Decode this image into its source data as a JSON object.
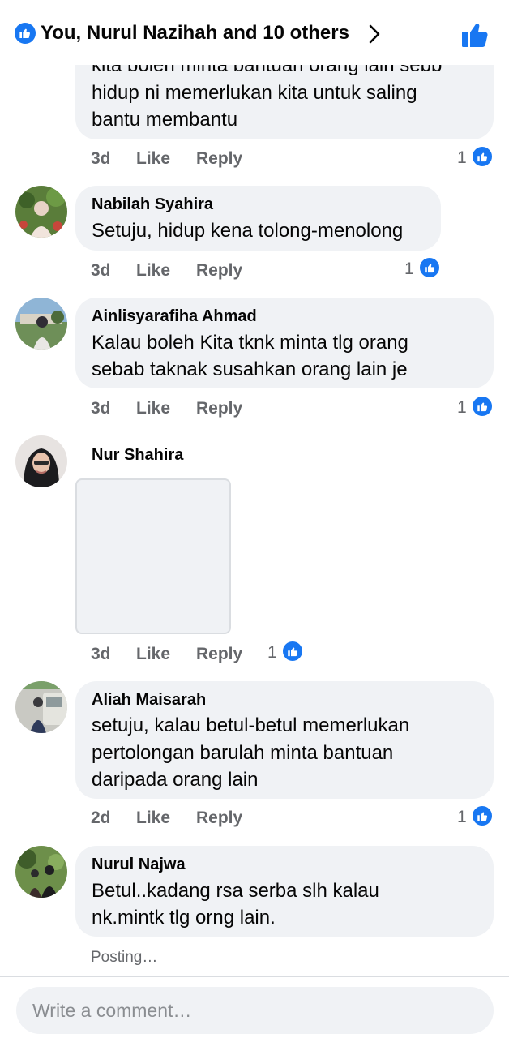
{
  "header": {
    "title": "You, Nurul Nazihah and 10 others"
  },
  "colors": {
    "accent": "#1877f2",
    "bubble": "#f0f2f5",
    "meta": "#65676b"
  },
  "comments": [
    {
      "name": "",
      "lines": [
        "kita boleh minta bantuan orang lain sebb",
        "hidup ni memerlukan kita untuk saling",
        "bantu membantu"
      ],
      "time": "3d",
      "like": "Like",
      "reply": "Reply",
      "reactions": "1"
    },
    {
      "name": "Nabilah Syahira",
      "lines": [
        "Setuju, hidup kena tolong-menolong"
      ],
      "time": "3d",
      "like": "Like",
      "reply": "Reply",
      "reactions": "1"
    },
    {
      "name": "Ainlisyarafiha Ahmad",
      "lines": [
        "Kalau boleh Kita tknk minta tlg orang",
        "sebab taknak susahkan orang lain je"
      ],
      "time": "3d",
      "like": "Like",
      "reply": "Reply",
      "reactions": "1"
    },
    {
      "name": "Nur Shahira",
      "lines": [],
      "time": "3d",
      "like": "Like",
      "reply": "Reply",
      "reactions": "1"
    },
    {
      "name": "Aliah Maisarah",
      "lines": [
        "setuju, kalau betul-betul memerlukan",
        "pertolongan barulah minta bantuan",
        "daripada orang lain"
      ],
      "time": "2d",
      "like": "Like",
      "reply": "Reply",
      "reactions": "1"
    },
    {
      "name": "Nurul Najwa",
      "lines": [
        "Betul..kadang rsa serba slh kalau",
        "nk.mintk tlg orng lain."
      ],
      "status": "Posting…"
    }
  ],
  "composer": {
    "placeholder": "Write a comment…"
  }
}
